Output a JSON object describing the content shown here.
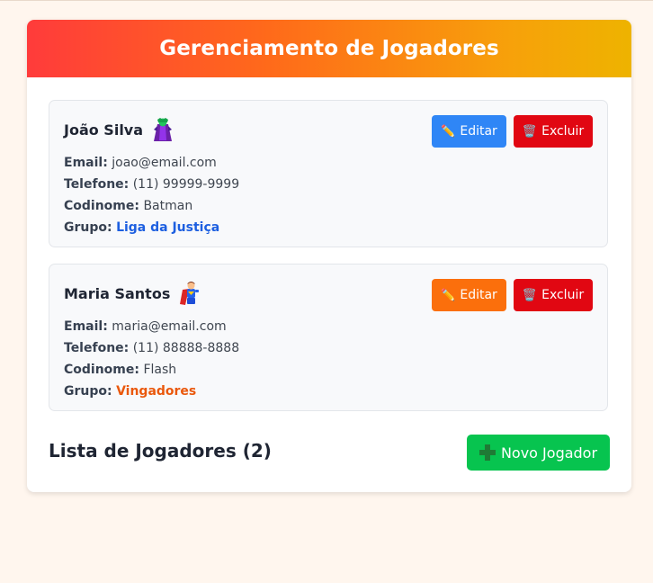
{
  "header": {
    "title": "Gerenciamento de Jogadores"
  },
  "players": [
    {
      "name": "João Silva",
      "avatar_icon": "villain-icon",
      "email_label": "Email:",
      "email": "joao@email.com",
      "phone_label": "Telefone:",
      "phone": "(11) 99999-9999",
      "codename_label": "Codinome:",
      "codename": "Batman",
      "group_label": "Grupo:",
      "group": "Liga da Justiça",
      "group_color": "#1d5fe0",
      "edit_label": "Editar",
      "edit_color": "#2f86f6",
      "delete_label": "Excluir"
    },
    {
      "name": "Maria Santos",
      "avatar_icon": "superhero-icon",
      "email_label": "Email:",
      "email": "maria@email.com",
      "phone_label": "Telefone:",
      "phone": "(11) 88888-8888",
      "codename_label": "Codinome:",
      "codename": "Flash",
      "group_label": "Grupo:",
      "group": "Vingadores",
      "group_color": "#ea580c",
      "edit_label": "Editar",
      "edit_color": "#fb6f0c",
      "delete_label": "Excluir"
    }
  ],
  "footer": {
    "list_title": "Lista de Jogadores (2)",
    "new_player_label": "Novo Jogador"
  },
  "colors": {
    "delete": "#e10712",
    "new_player": "#07c44f",
    "background": "#fff6ee"
  }
}
